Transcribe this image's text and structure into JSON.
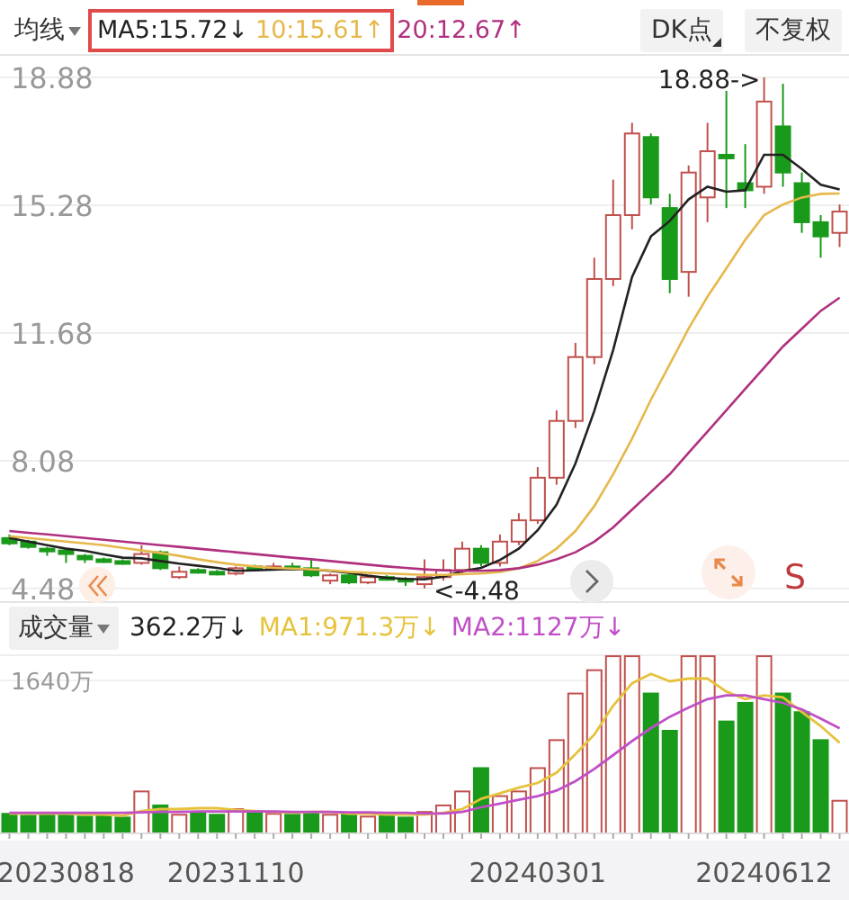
{
  "indicator_bar": {
    "menu_label": "均线",
    "ma_values": [
      {
        "text": "MA5:15.72↓",
        "color": "#222222",
        "boxed": true
      },
      {
        "text": "10:15.61↑",
        "color": "#e6b84c",
        "boxed": true
      },
      {
        "text": "20:12.67↑",
        "color": "#b0307f",
        "boxed": false
      }
    ],
    "buttons": [
      {
        "label": "DK点",
        "kind": "dropdown"
      },
      {
        "label": "不复权",
        "kind": "plain"
      }
    ]
  },
  "price_chart": {
    "chart_data": {
      "type": "candlestick",
      "grid": true,
      "ylim": [
        4.07,
        19.54
      ],
      "categories": [
        null,
        null,
        null,
        null,
        null,
        null,
        null,
        null,
        null,
        null,
        null,
        null,
        null,
        null,
        null,
        null,
        null,
        null,
        null,
        null,
        null,
        null,
        null,
        null,
        null,
        null,
        null,
        null,
        null,
        null,
        null,
        null,
        null,
        null,
        null,
        null,
        null,
        null,
        null,
        null,
        null,
        null,
        null,
        null,
        null
      ],
      "yticks": [
        {
          "value": 18.88,
          "label": "18.88"
        },
        {
          "value": 15.28,
          "label": "15.28"
        },
        {
          "value": 11.68,
          "label": "11.68"
        },
        {
          "value": 8.08,
          "label": "8.08"
        },
        {
          "value": 4.48,
          "label": "4.48"
        }
      ],
      "ohlc": [
        [
          5.9,
          6.0,
          5.7,
          5.75
        ],
        [
          5.8,
          5.85,
          5.6,
          5.65
        ],
        [
          5.6,
          5.65,
          5.4,
          5.55
        ],
        [
          5.55,
          5.6,
          5.2,
          5.45
        ],
        [
          5.4,
          5.45,
          5.2,
          5.3
        ],
        [
          5.3,
          5.35,
          5.2,
          5.25
        ],
        [
          5.25,
          5.3,
          5.15,
          5.2
        ],
        [
          5.2,
          5.7,
          5.15,
          5.45
        ],
        [
          5.5,
          5.55,
          5.0,
          5.05
        ],
        [
          4.8,
          5.1,
          4.75,
          4.95
        ],
        [
          5.0,
          5.05,
          4.9,
          4.95
        ],
        [
          4.95,
          5.0,
          4.85,
          4.9
        ],
        [
          4.9,
          5.1,
          4.85,
          5.05
        ],
        [
          5.1,
          5.15,
          5.0,
          5.05
        ],
        [
          5.05,
          5.2,
          5.0,
          5.1
        ],
        [
          5.1,
          5.2,
          5.0,
          5.05
        ],
        [
          5.05,
          5.3,
          4.8,
          4.85
        ],
        [
          4.7,
          4.9,
          4.6,
          4.85
        ],
        [
          4.85,
          4.9,
          4.6,
          4.65
        ],
        [
          4.65,
          4.85,
          4.6,
          4.8
        ],
        [
          4.8,
          4.85,
          4.7,
          4.75
        ],
        [
          4.75,
          4.8,
          4.55,
          4.7
        ],
        [
          4.6,
          5.3,
          4.48,
          4.8
        ],
        [
          4.8,
          5.3,
          4.7,
          5.0
        ],
        [
          5.0,
          5.8,
          4.9,
          5.6
        ],
        [
          5.6,
          5.7,
          5.1,
          5.2
        ],
        [
          5.2,
          6.0,
          5.1,
          5.8
        ],
        [
          5.8,
          6.6,
          5.7,
          6.4
        ],
        [
          6.4,
          7.9,
          6.3,
          7.6
        ],
        [
          7.6,
          9.5,
          7.4,
          9.2
        ],
        [
          9.2,
          11.4,
          9.0,
          11.0
        ],
        [
          11.0,
          13.8,
          10.8,
          13.2
        ],
        [
          13.2,
          16.0,
          13.0,
          15.0
        ],
        [
          15.0,
          17.6,
          14.6,
          17.3
        ],
        [
          17.2,
          17.3,
          15.3,
          15.5
        ],
        [
          15.2,
          15.6,
          12.8,
          13.2
        ],
        [
          13.4,
          16.4,
          12.7,
          16.2
        ],
        [
          15.5,
          17.6,
          14.8,
          16.8
        ],
        [
          16.7,
          18.5,
          15.2,
          16.6
        ],
        [
          15.9,
          17.0,
          15.2,
          15.7
        ],
        [
          15.8,
          18.88,
          15.6,
          18.2
        ],
        [
          17.5,
          18.7,
          15.8,
          16.2
        ],
        [
          15.9,
          16.2,
          14.5,
          14.8
        ],
        [
          14.8,
          15.0,
          13.8,
          14.4
        ],
        [
          14.5,
          15.3,
          14.1,
          15.1
        ]
      ],
      "series": [
        {
          "type": "line",
          "color": "#222222",
          "values": [
            5.9,
            5.8,
            5.7,
            5.6,
            5.54,
            5.44,
            5.35,
            5.33,
            5.25,
            5.18,
            5.12,
            5.06,
            4.98,
            4.99,
            5.01,
            5.03,
            5.02,
            4.98,
            4.92,
            4.84,
            4.78,
            4.75,
            4.74,
            4.81,
            4.97,
            5.06,
            5.28,
            5.6,
            6.12,
            6.84,
            8.0,
            9.48,
            11.2,
            13.26,
            14.4,
            14.84,
            15.44,
            15.8,
            15.66,
            15.7,
            16.7,
            16.7,
            16.3,
            15.86,
            15.72
          ]
        },
        {
          "type": "line",
          "color": "#e6b84c",
          "values": [
            5.95,
            5.9,
            5.85,
            5.8,
            5.75,
            5.7,
            5.62,
            5.55,
            5.48,
            5.4,
            5.3,
            5.22,
            5.15,
            5.1,
            5.06,
            5.04,
            5.02,
            4.99,
            4.95,
            4.92,
            4.9,
            4.88,
            4.86,
            4.86,
            4.88,
            4.9,
            4.95,
            5.05,
            5.25,
            5.6,
            6.1,
            6.8,
            7.7,
            8.7,
            9.8,
            10.8,
            11.8,
            12.7,
            13.5,
            14.3,
            15.0,
            15.3,
            15.5,
            15.6,
            15.61
          ]
        },
        {
          "type": "line",
          "color": "#b0307f",
          "values": [
            6.1,
            6.05,
            6.0,
            5.95,
            5.9,
            5.85,
            5.8,
            5.75,
            5.7,
            5.65,
            5.6,
            5.55,
            5.5,
            5.45,
            5.4,
            5.35,
            5.3,
            5.25,
            5.2,
            5.15,
            5.1,
            5.06,
            5.02,
            4.99,
            4.98,
            4.98,
            5.0,
            5.05,
            5.15,
            5.3,
            5.5,
            5.8,
            6.2,
            6.7,
            7.2,
            7.7,
            8.3,
            8.9,
            9.5,
            10.1,
            10.7,
            11.3,
            11.8,
            12.3,
            12.67
          ]
        }
      ],
      "annotations": [
        "18.88->",
        "<-4.48"
      ]
    },
    "marker_label": "S"
  },
  "volume_bar": {
    "menu_label": "成交量",
    "values": [
      {
        "text": "362.2万↓",
        "color": "#222222"
      },
      {
        "text": "MA1:971.3万↓",
        "color": "#e6c23c"
      },
      {
        "text": "MA2:1127万↓",
        "color": "#c04fc8"
      }
    ]
  },
  "volume_chart": {
    "chart_data": {
      "type": "bar",
      "ylim": [
        0,
        1930
      ],
      "yticks": [
        {
          "value": 1640,
          "label": "1640万"
        }
      ],
      "categories": [
        null,
        null,
        null,
        "20230818",
        null,
        null,
        null,
        null,
        null,
        null,
        null,
        null,
        "20231110",
        null,
        null,
        null,
        null,
        null,
        null,
        null,
        null,
        null,
        null,
        null,
        null,
        null,
        null,
        null,
        "20240301",
        null,
        null,
        null,
        null,
        null,
        null,
        null,
        null,
        null,
        null,
        null,
        "20240612",
        null,
        null,
        null,
        null
      ],
      "series": [
        {
          "type": "bar",
          "colors": [
            "#1a9a1a",
            "#1a9a1a",
            "#1a9a1a",
            "#1a9a1a",
            "#1a9a1a",
            "#1a9a1a",
            "#1a9a1a",
            "#c0504d",
            "#1a9a1a",
            "#c0504d",
            "#1a9a1a",
            "#1a9a1a",
            "#c0504d",
            "#1a9a1a",
            "#c0504d",
            "#1a9a1a",
            "#1a9a1a",
            "#c0504d",
            "#1a9a1a",
            "#c0504d",
            "#1a9a1a",
            "#1a9a1a",
            "#c0504d",
            "#c0504d",
            "#c0504d",
            "#1a9a1a",
            "#c0504d",
            "#c0504d",
            "#c0504d",
            "#c0504d",
            "#c0504d",
            "#c0504d",
            "#c0504d",
            "#c0504d",
            "#1a9a1a",
            "#1a9a1a",
            "#c0504d",
            "#c0504d",
            "#1a9a1a",
            "#1a9a1a",
            "#c0504d",
            "#1a9a1a",
            "#1a9a1a",
            "#1a9a1a",
            "#c0504d"
          ],
          "values": [
            210,
            190,
            220,
            200,
            180,
            190,
            170,
            450,
            300,
            200,
            220,
            200,
            260,
            230,
            210,
            200,
            230,
            200,
            220,
            180,
            190,
            170,
            230,
            300,
            450,
            700,
            400,
            450,
            700,
            1000,
            1500,
            1750,
            1900,
            1900,
            1500,
            1100,
            1900,
            1900,
            1200,
            1400,
            1900,
            1500,
            1300,
            1000,
            350
          ]
        },
        {
          "type": "line",
          "color": "#e6c23c",
          "values": [
            210,
            210,
            210,
            210,
            200,
            200,
            190,
            240,
            260,
            260,
            270,
            270,
            250,
            240,
            230,
            220,
            230,
            230,
            210,
            210,
            200,
            200,
            200,
            220,
            260,
            370,
            430,
            490,
            540,
            650,
            850,
            1060,
            1370,
            1610,
            1710,
            1630,
            1660,
            1660,
            1520,
            1440,
            1480,
            1460,
            1300,
            1150,
            971
          ]
        },
        {
          "type": "line",
          "color": "#c04fc8",
          "values": [
            220,
            220,
            220,
            220,
            220,
            220,
            220,
            225,
            230,
            230,
            235,
            235,
            235,
            235,
            235,
            230,
            230,
            230,
            225,
            225,
            220,
            220,
            215,
            215,
            230,
            280,
            320,
            360,
            400,
            460,
            560,
            690,
            840,
            990,
            1130,
            1250,
            1350,
            1440,
            1480,
            1480,
            1440,
            1400,
            1330,
            1230,
            1127
          ]
        }
      ]
    }
  }
}
